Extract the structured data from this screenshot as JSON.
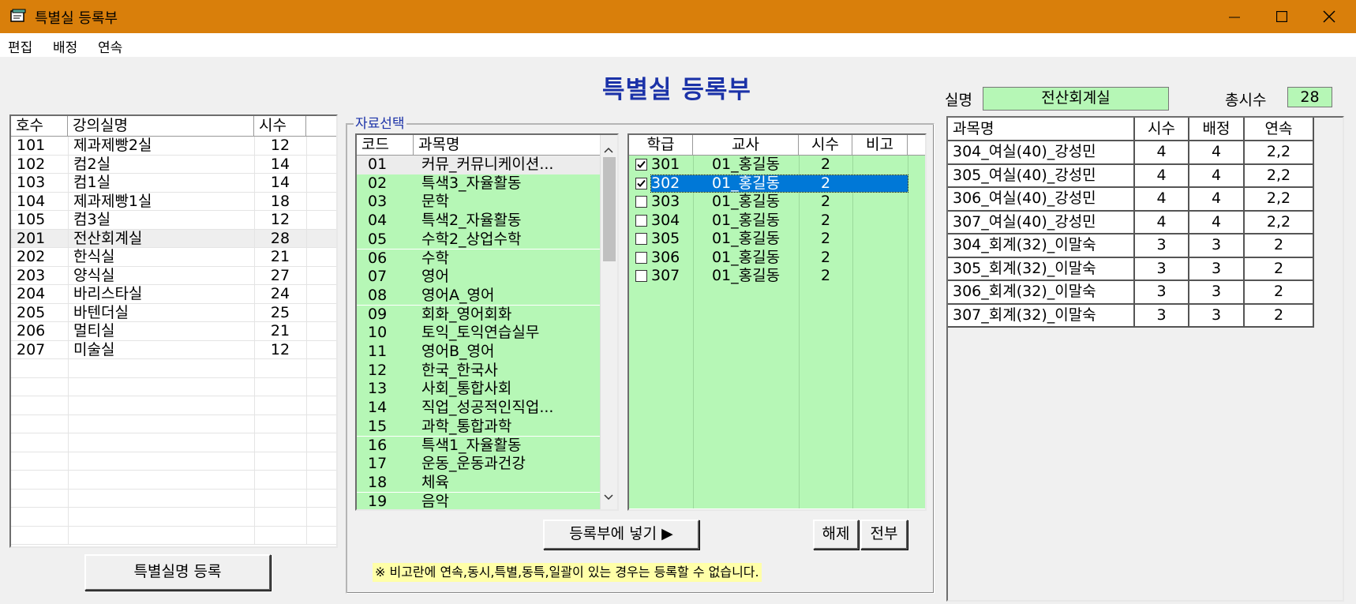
{
  "window": {
    "title": "특별실 등록부",
    "minimize": "minimize",
    "maximize": "maximize",
    "close": "close"
  },
  "menu": [
    "편집",
    "배정",
    "연속"
  ],
  "page_title": "특별실 등록부",
  "room_list": {
    "headers": [
      "호수",
      "강의실명",
      "시수"
    ],
    "rows": [
      [
        "101",
        "제과제빵2실",
        "12"
      ],
      [
        "102",
        "컴2실",
        "14"
      ],
      [
        "103",
        "컴1실",
        "14"
      ],
      [
        "104",
        "제과제빵1실",
        "18"
      ],
      [
        "105",
        "컴3실",
        "12"
      ],
      [
        "201",
        "전산회계실",
        "28"
      ],
      [
        "202",
        "한식실",
        "21"
      ],
      [
        "203",
        "양식실",
        "27"
      ],
      [
        "204",
        "바리스타실",
        "24"
      ],
      [
        "205",
        "바텐더실",
        "25"
      ],
      [
        "206",
        "멀티실",
        "21"
      ],
      [
        "207",
        "미술실",
        "12"
      ]
    ],
    "selected_index": 5
  },
  "register_room_button": "특별실명 등록",
  "data_select_label": "자료선택",
  "subject_list": {
    "headers": [
      "코드",
      "과목명"
    ],
    "rows": [
      [
        "01",
        "커뮤_커뮤니케이션..."
      ],
      [
        "02",
        "특색3_자율활동"
      ],
      [
        "03",
        "문학"
      ],
      [
        "04",
        "특색2_자율활동"
      ],
      [
        "05",
        "수학2_상업수학"
      ],
      [
        "06",
        "수학"
      ],
      [
        "07",
        "영어"
      ],
      [
        "08",
        "영어A_영어"
      ],
      [
        "09",
        "회화_영어회화"
      ],
      [
        "10",
        "토익_토익연습실무"
      ],
      [
        "11",
        "영어B_영어"
      ],
      [
        "12",
        "한국_한국사"
      ],
      [
        "13",
        "사회_통합사회"
      ],
      [
        "14",
        "직업_성공적인직업..."
      ],
      [
        "15",
        "과학_통합과학"
      ],
      [
        "16",
        "특색1_자율활동"
      ],
      [
        "17",
        "운동_운동과건강"
      ],
      [
        "18",
        "체육"
      ],
      [
        "19",
        "음악"
      ]
    ]
  },
  "class_list": {
    "headers": [
      "학급",
      "교사",
      "시수",
      "비고"
    ],
    "rows": [
      {
        "class": "301",
        "teacher": "01_홍길동",
        "hours": "2",
        "note": "",
        "checked": true
      },
      {
        "class": "302",
        "teacher": "01_홍길동",
        "hours": "2",
        "note": "",
        "checked": true
      },
      {
        "class": "303",
        "teacher": "01_홍길동",
        "hours": "2",
        "note": "",
        "checked": false
      },
      {
        "class": "304",
        "teacher": "01_홍길동",
        "hours": "2",
        "note": "",
        "checked": false
      },
      {
        "class": "305",
        "teacher": "01_홍길동",
        "hours": "2",
        "note": "",
        "checked": false
      },
      {
        "class": "306",
        "teacher": "01_홍길동",
        "hours": "2",
        "note": "",
        "checked": false
      },
      {
        "class": "307",
        "teacher": "01_홍길동",
        "hours": "2",
        "note": "",
        "checked": false
      }
    ],
    "selected_index": 1
  },
  "insert_button": "등록부에 넣기 ▶",
  "release_button": "해제",
  "all_button": "전부",
  "note_text": "※ 비고란에 연속,동시,특별,동특,일괄이 있는 경우는 등록할  수 없습니다.",
  "room_name_label": "실명",
  "room_name_value": "전산회계실",
  "total_hours_label": "총시수",
  "total_hours_value": "28",
  "register_table": {
    "headers": [
      "과목명",
      "시수",
      "배정",
      "연속"
    ],
    "rows": [
      [
        "304_여실(40)_강성민",
        "4",
        "4",
        "2,2"
      ],
      [
        "305_여실(40)_강성민",
        "4",
        "4",
        "2,2"
      ],
      [
        "306_여실(40)_강성민",
        "4",
        "4",
        "2,2"
      ],
      [
        "307_여실(40)_강성민",
        "4",
        "4",
        "2,2"
      ],
      [
        "304_회계(32)_이말숙",
        "3",
        "3",
        "2"
      ],
      [
        "305_회계(32)_이말숙",
        "3",
        "3",
        "2"
      ],
      [
        "306_회계(32)_이말숙",
        "3",
        "3",
        "2"
      ],
      [
        "307_회계(32)_이말숙",
        "3",
        "3",
        "2"
      ]
    ]
  },
  "colors": {
    "titlebar": "#d97f0b",
    "title_text": "#1b32a8",
    "green_cell": "#b6f7b6",
    "selection": "#0078d7",
    "note_bg": "#ffffa8"
  }
}
